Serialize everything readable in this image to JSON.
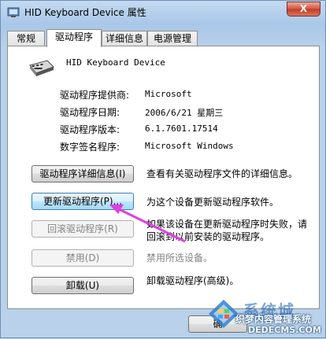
{
  "window": {
    "title": "HID Keyboard Device 属性",
    "close_glyph": "X"
  },
  "tabs": [
    {
      "label": "常规",
      "active": false
    },
    {
      "label": "驱动程序",
      "active": true
    },
    {
      "label": "详细信息",
      "active": false
    },
    {
      "label": "电源管理",
      "active": false
    }
  ],
  "device": {
    "name": "HID Keyboard Device",
    "icon": "keyboard-icon"
  },
  "info": [
    {
      "label": "驱动程序提供商:",
      "value": "Microsoft"
    },
    {
      "label": "驱动程序日期:",
      "value": "2006/6/21 星期三"
    },
    {
      "label": "驱动程序版本:",
      "value": "6.1.7601.17514"
    },
    {
      "label": "数字签名程序:",
      "value": "Microsoft Windows"
    }
  ],
  "actions": [
    {
      "label": "驱动程序详细信息(I)",
      "desc": "查看有关驱动程序文件的详细信息。",
      "enabled": true
    },
    {
      "label": "更新驱动程序(P)...",
      "desc": "为这个设备更新驱动程序软件。",
      "enabled": true
    },
    {
      "label": "回滚驱动程序(R)",
      "desc": "如果该设备在更新驱动程序时失败，请回滚到以前安装的驱动程序。",
      "enabled": false
    },
    {
      "label": "禁用(D)",
      "desc": "禁用所选设备。",
      "enabled": false
    },
    {
      "label": "卸载(U)",
      "desc": "卸载驱动程序(高级)。",
      "enabled": true
    }
  ],
  "footer": {
    "ok_label": "确"
  },
  "watermark": {
    "brand": "系统城",
    "slogan": "织梦内容管理系统",
    "site": "DEDECMS.COM",
    "url": "xitongcheng.com"
  },
  "colors": {
    "annotation_arrow": "#e040e0"
  }
}
